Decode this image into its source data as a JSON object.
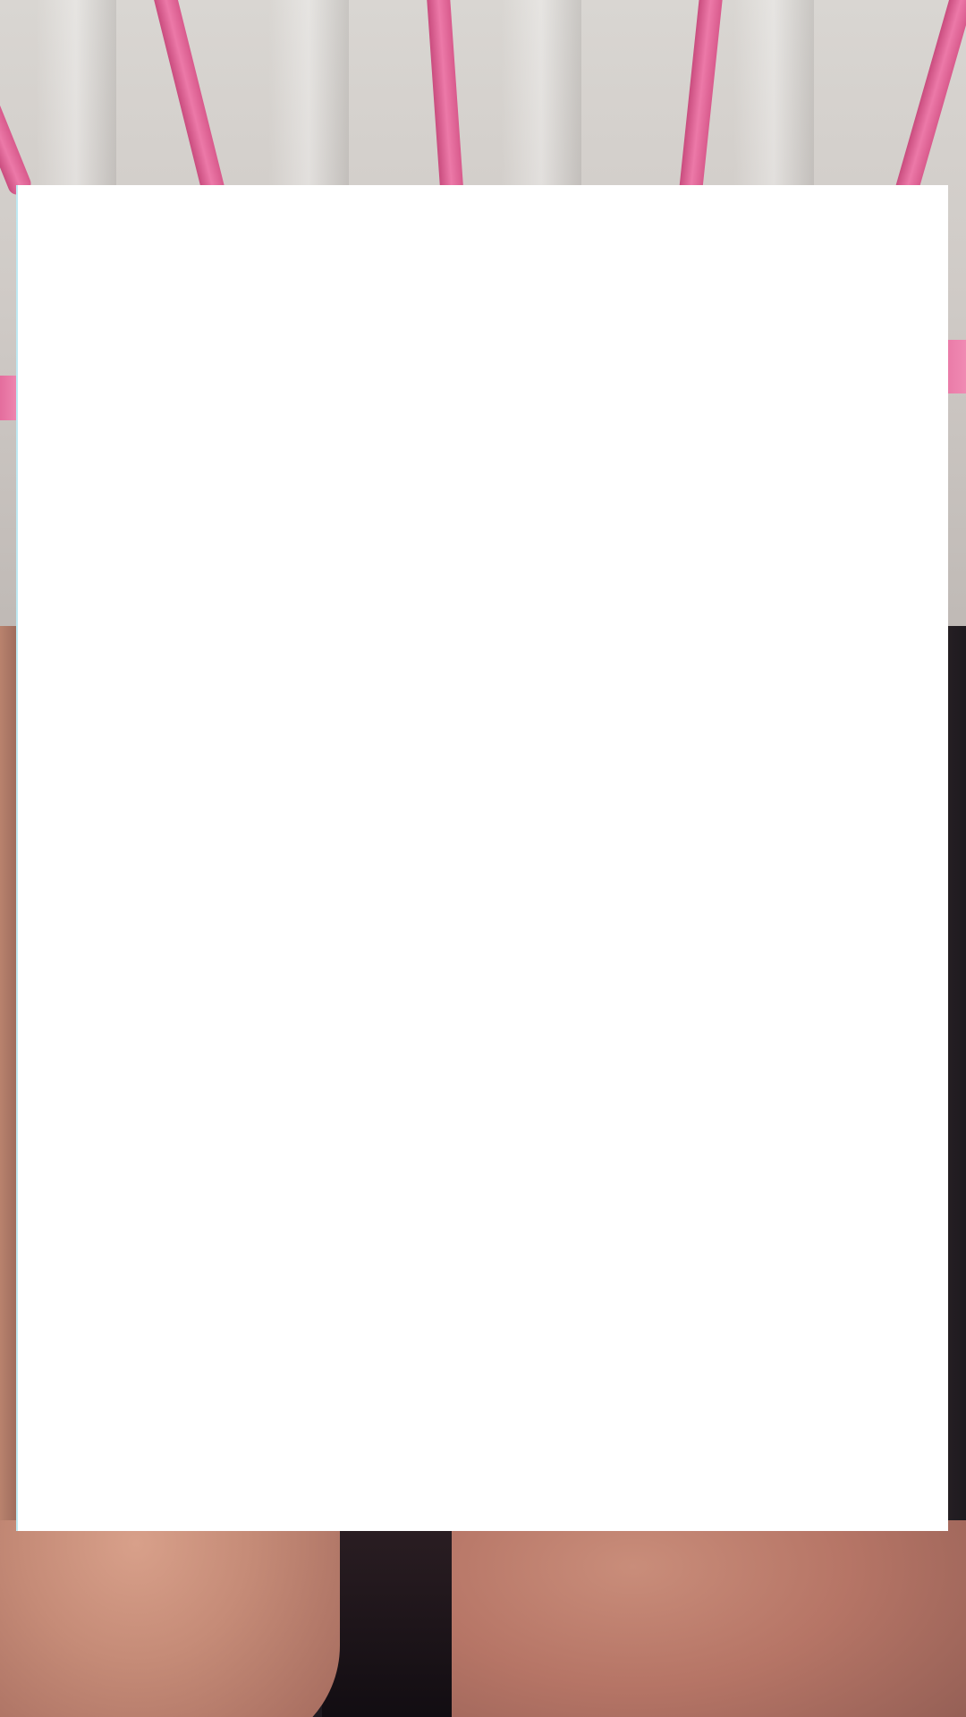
{
  "screen": {
    "description_free": true
  },
  "background": {
    "accent_pink": "#ec79a8",
    "fabric_color": "#d5d1cd",
    "skin_color": "#c58b77"
  },
  "overlay": {
    "fill": "#ffffff",
    "content": ""
  }
}
